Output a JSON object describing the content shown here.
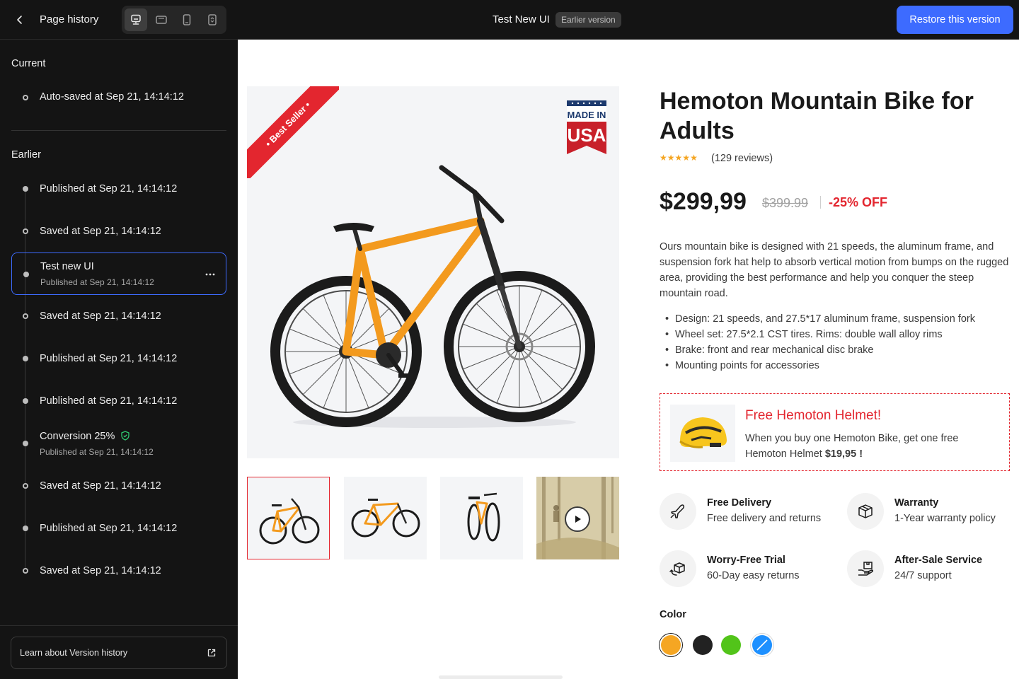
{
  "topbar": {
    "title": "Page history",
    "page_name": "Test New UI",
    "version_badge": "Earlier version",
    "restore_label": "Restore this version",
    "devices": [
      "desktop",
      "tablet-landscape",
      "tablet-portrait",
      "responsive"
    ]
  },
  "sidebar": {
    "current_title": "Current",
    "current_item": "Auto-saved at Sep 21, 14:14:12",
    "earlier_title": "Earlier",
    "items": [
      {
        "label": "Published at Sep 21, 14:14:12",
        "sub": ""
      },
      {
        "label": "Saved at Sep 21, 14:14:12",
        "sub": ""
      },
      {
        "label": "Test new UI",
        "sub": "Published at Sep 21, 14:14:12",
        "selected": true
      },
      {
        "label": "Saved at Sep 21, 14:14:12",
        "sub": ""
      },
      {
        "label": "Published at Sep 21, 14:14:12",
        "sub": ""
      },
      {
        "label": "Published at Sep 21, 14:14:12",
        "sub": ""
      },
      {
        "label": "Conversion 25%",
        "sub": "Published at Sep 21, 14:14:12",
        "verified": true
      },
      {
        "label": "Saved at Sep 21, 14:14:12",
        "sub": ""
      },
      {
        "label": "Published at Sep 21, 14:14:12",
        "sub": ""
      },
      {
        "label": "Saved at Sep 21, 14:14:12",
        "sub": ""
      }
    ],
    "footer_link": "Learn about Version history"
  },
  "product": {
    "ribbon": "Best Seller",
    "badge_line1": "MADE IN",
    "badge_line2": "USA",
    "title": "Hemoton Mountain Bike for Adults",
    "rating": 5,
    "reviews": "(129 reviews)",
    "price": "$299,99",
    "old_price": "$399.99",
    "discount": "-25% OFF",
    "description": "Ours mountain bike is designed with 21 speeds, the aluminum frame, and suspension fork hat help to absorb vertical motion from bumps on the rugged area, providing the best performance and help you conquer the steep mountain road.",
    "features": [
      "Design: 21 speeds, and 27.5*17 aluminum frame, suspension fork",
      "Wheel set: 27.5*2.1 CST tires. Rims: double wall alloy rims",
      "Brake: front and rear mechanical disc brake",
      "Mounting points for accessories"
    ],
    "promo": {
      "title": "Free Hemoton Helmet!",
      "text": "When you buy one Hemoton Bike, get one free Hemoton Helmet",
      "price": "$19,95 !"
    },
    "services": [
      {
        "icon": "plane-icon",
        "title": "Free Delivery",
        "sub": "Free delivery and returns"
      },
      {
        "icon": "box-icon",
        "title": "Warranty",
        "sub": "1-Year warranty policy"
      },
      {
        "icon": "return-box-icon",
        "title": "Worry-Free Trial",
        "sub": "60-Day easy returns"
      },
      {
        "icon": "hand-box-icon",
        "title": "After-Sale Service",
        "sub": "24/7 support"
      }
    ],
    "color_label": "Color",
    "colors": [
      "#f5a623",
      "#222222",
      "#52c41a",
      "#1e90ff"
    ],
    "selected_color": 0,
    "bike_color": "#f39a1e",
    "accent_red": "#e3262f",
    "accent_blue": "#3d6bff"
  }
}
